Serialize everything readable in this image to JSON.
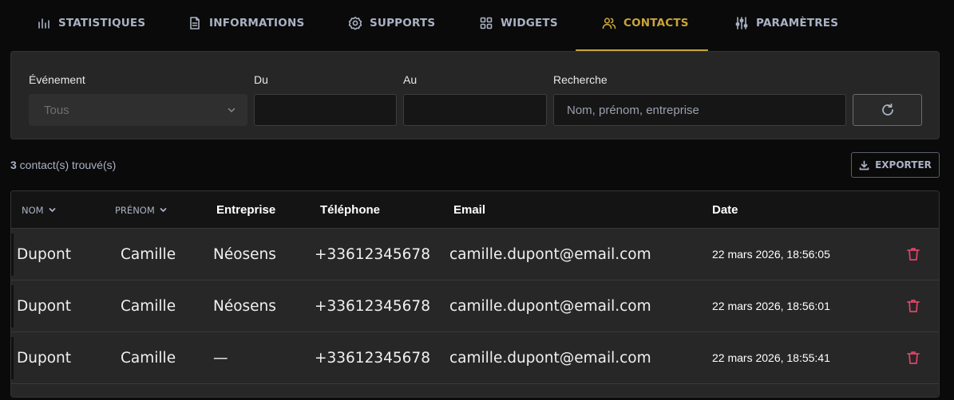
{
  "tabs": [
    {
      "label": "STATISTIQUES",
      "icon": "bar-chart-icon"
    },
    {
      "label": "INFORMATIONS",
      "icon": "document-icon"
    },
    {
      "label": "SUPPORTS",
      "icon": "badge-icon"
    },
    {
      "label": "WIDGETS",
      "icon": "grid-icon"
    },
    {
      "label": "CONTACTS",
      "icon": "users-icon",
      "active": true
    },
    {
      "label": "PARAMÈTRES",
      "icon": "sliders-icon"
    }
  ],
  "filters": {
    "event_label": "Événement",
    "event_value": "Tous",
    "from_label": "Du",
    "to_label": "Au",
    "search_label": "Recherche",
    "search_placeholder": "Nom, prénom, entreprise"
  },
  "results": {
    "count": "3",
    "count_suffix": " contact(s) trouvé(s)",
    "export_label": "EXPORTER"
  },
  "table": {
    "headers": {
      "nom": "NOM",
      "prenom": "PRÉNOM",
      "entreprise": "Entreprise",
      "telephone": "Téléphone",
      "email": "Email",
      "date": "Date"
    },
    "rows": [
      {
        "nom": "Dupont",
        "prenom": "Camille",
        "entreprise": "Néosens",
        "telephone": "+33612345678",
        "email": "camille.dupont@email.com",
        "date": "22 mars 2026, 18:56:05"
      },
      {
        "nom": "Dupont",
        "prenom": "Camille",
        "entreprise": "Néosens",
        "telephone": "+33612345678",
        "email": "camille.dupont@email.com",
        "date": "22 mars 2026, 18:56:01"
      },
      {
        "nom": "Dupont",
        "prenom": "Camille",
        "entreprise": "—",
        "telephone": "+33612345678",
        "email": "camille.dupont@email.com",
        "date": "22 mars 2026, 18:55:41"
      }
    ]
  },
  "colors": {
    "accent": "#c9a43a",
    "danger": "#e0456a",
    "muted": "#aab2c4"
  }
}
